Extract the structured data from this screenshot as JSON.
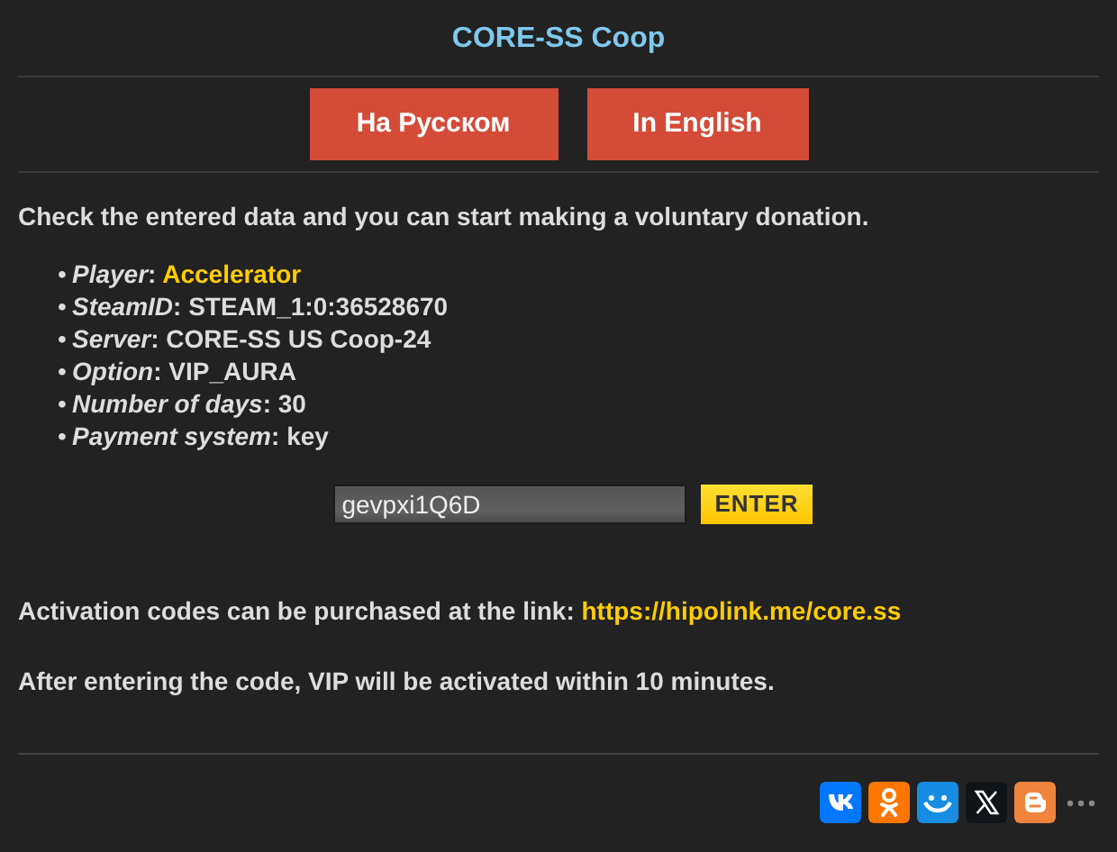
{
  "title": "CORE-SS Coop",
  "language_buttons": [
    {
      "label": "На Русском"
    },
    {
      "label": "In English"
    }
  ],
  "intro": "Check the entered data and you can start making a voluntary donation.",
  "details": [
    {
      "bullet": "•",
      "label": "Player",
      "separator": ":",
      "value": "Accelerator",
      "kind": "highlight"
    },
    {
      "bullet": "•",
      "label": "SteamID",
      "separator": ":",
      "value": "STEAM_1:0:36528670",
      "kind": "plain"
    },
    {
      "bullet": "•",
      "label": "Server",
      "separator": ":",
      "value": "CORE-SS US Coop-24",
      "kind": "plain"
    },
    {
      "bullet": "•",
      "label": "Option",
      "separator": ":",
      "value": "VIP_AURA",
      "kind": "plain"
    },
    {
      "bullet": "•",
      "label": "Number of days",
      "separator": ":",
      "value": "30",
      "kind": "plain"
    },
    {
      "bullet": "•",
      "label": "Payment system",
      "separator": ":",
      "value": "key",
      "kind": "plain"
    }
  ],
  "code_field": {
    "value": "gevpxi1Q6D"
  },
  "enter_button": "ENTER",
  "purchase": {
    "text": "Activation codes can be purchased at the link:",
    "link": "https://hipolink.me/core.ss"
  },
  "note": "After entering the code, VIP will be activated within 10 minutes.",
  "share": [
    {
      "kind": "vk",
      "color": "#0077ff"
    },
    {
      "kind": "ok",
      "color": "#ff7700"
    },
    {
      "kind": "smile",
      "color": "#168de2"
    },
    {
      "kind": "x",
      "color": "#0f1419"
    },
    {
      "kind": "blogger",
      "color": "#f0843c"
    },
    {
      "kind": "more"
    }
  ]
}
